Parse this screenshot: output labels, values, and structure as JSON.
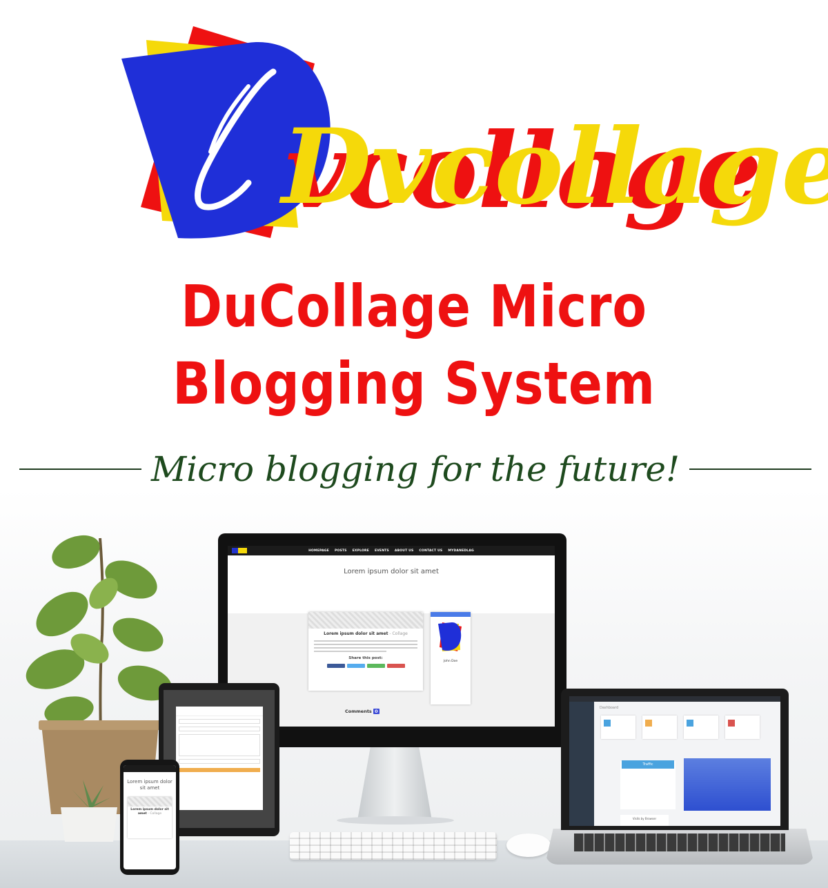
{
  "brand": {
    "logo_wordmark": "Dvcollage",
    "headline_line1": "DuCollage Micro",
    "headline_line2": "Blogging System",
    "tagline": "Micro blogging for the future!",
    "colors": {
      "red": "#ee1111",
      "yellow": "#f5d90a",
      "blue": "#1f2fd8",
      "tagline": "#1e4a1e"
    }
  },
  "monitor": {
    "nav": [
      "HOMEPAGE",
      "POSTS",
      "EXPLORE",
      "EVENTS",
      "ABOUT US",
      "CONTACT US",
      "MYDANEDLAG"
    ],
    "hero_title": "Lorem ipsum dolor sit amet",
    "post_title": "Lorem ipsum dolor sit amet",
    "post_category": " - Collage",
    "share_label": "Share this post:",
    "profile_name": "John Doe",
    "comments_label": "Comments",
    "comments_count": "0"
  },
  "phone": {
    "title": "Lorem ipsum dolor sit amet",
    "post_title": "Lorem ipsum dolor sit amet",
    "post_category": " - Collage"
  },
  "laptop": {
    "page_title": "Dashboard",
    "traffic_label": "Traffic",
    "visits_label": "Visits by Browser"
  },
  "icons": [
    "plant-icon",
    "keyboard-icon",
    "mouse-icon"
  ]
}
